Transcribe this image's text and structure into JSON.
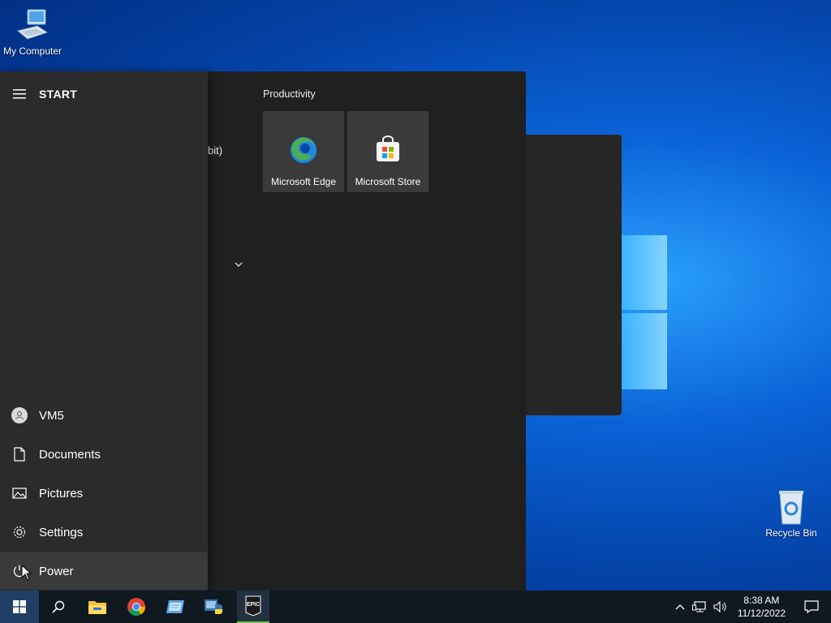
{
  "desktop": {
    "icons": [
      {
        "label": "My Computer",
        "icon": "computer-icon"
      },
      {
        "label": "Recycle Bin",
        "icon": "recycle-bin-icon"
      }
    ]
  },
  "start_menu": {
    "title": "START",
    "partial_app_text": "bit)",
    "rail": {
      "user": "VM5",
      "documents": "Documents",
      "pictures": "Pictures",
      "settings": "Settings",
      "power": "Power"
    },
    "group_label": "Productivity",
    "tiles": [
      {
        "label": "Microsoft Edge",
        "icon": "edge-icon"
      },
      {
        "label": "Microsoft Store",
        "icon": "store-icon"
      }
    ]
  },
  "taskbar": {
    "apps": [
      "start-button",
      "search",
      "file-explorer",
      "chrome",
      "app-window",
      "python",
      "epic-games"
    ],
    "epic_label": "EPIC",
    "clock": {
      "time": "8:38 AM",
      "date": "11/12/2022"
    }
  }
}
